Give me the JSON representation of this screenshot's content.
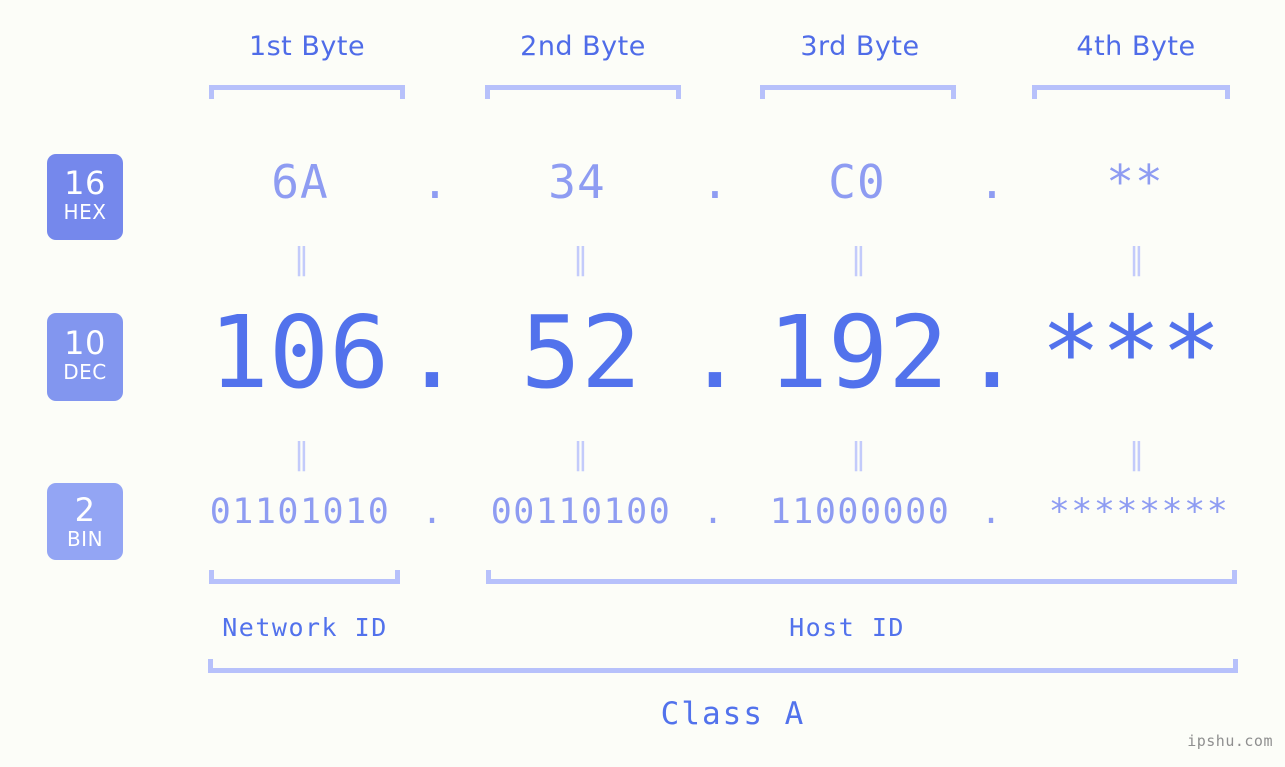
{
  "meta": {
    "watermark": "ipshu.com"
  },
  "headers": [
    {
      "label": "1st Byte"
    },
    {
      "label": "2nd Byte"
    },
    {
      "label": "3rd Byte"
    },
    {
      "label": "4th Byte"
    }
  ],
  "rows": {
    "hex": {
      "badge_num": "16",
      "badge_base": "HEX",
      "badge_color": "#7588ec",
      "text_color": "#8e9cf2",
      "octets": [
        "6A",
        "34",
        "C0",
        "**"
      ],
      "separator": "."
    },
    "dec": {
      "badge_num": "10",
      "badge_base": "DEC",
      "badge_color": "#8296ef",
      "text_color": "#5272ec",
      "octets": [
        "106",
        "52",
        "192",
        "***"
      ],
      "separator": "."
    },
    "bin": {
      "badge_num": "2",
      "badge_base": "BIN",
      "badge_color": "#93a5f4",
      "text_color": "#8e9cf2",
      "octets": [
        "01101010",
        "00110100",
        "11000000",
        "********"
      ],
      "separator": "."
    }
  },
  "equality_separators": {
    "glyph": "‖",
    "count_per_gap": 4
  },
  "sections": [
    {
      "label": "Network ID"
    },
    {
      "label": "Host ID"
    }
  ],
  "class": {
    "label": "Class A"
  },
  "colors": {
    "background": "#fcfdf8",
    "bracket": "#b7c1fb",
    "accent_dark": "#5272ec",
    "accent_light": "#8e9cf2",
    "accent_pale": "#c3cbfb"
  }
}
